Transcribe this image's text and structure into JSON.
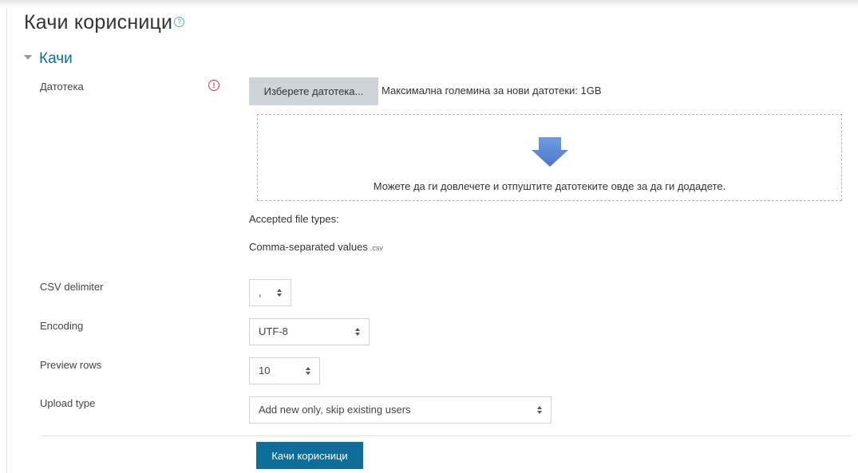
{
  "page": {
    "title": "Качи корисници",
    "help_glyph": "?"
  },
  "section": {
    "title": "Качи"
  },
  "file": {
    "label": "Датотека",
    "required_glyph": "!",
    "choose_button": "Изберете датотека...",
    "max_size": "Максимална големина за нови датотеки: 1GB",
    "drop_text": "Можете да ги довлечете и отпуштите датотеките овде за да ги додадете.",
    "accepted_label": "Accepted file types:",
    "accepted_type": "Comma-separated values",
    "accepted_ext": ".csv"
  },
  "fields": {
    "delimiter": {
      "label": "CSV delimiter",
      "value": ","
    },
    "encoding": {
      "label": "Encoding",
      "value": "UTF-8"
    },
    "preview": {
      "label": "Preview rows",
      "value": "10"
    },
    "upload_type": {
      "label": "Upload type",
      "value": "Add new only, skip existing users"
    }
  },
  "submit": {
    "label": "Качи корисници"
  },
  "colors": {
    "accent": "#0f6e99",
    "required": "#d33a3a",
    "help": "#5aa6ca",
    "arrow": "#5b89d6"
  },
  "icons": {
    "help": "question-circle-icon",
    "required": "exclamation-circle-icon",
    "collapse": "chevron-down-icon",
    "drop": "arrow-down-icon",
    "select_caret": "sort-icon"
  }
}
